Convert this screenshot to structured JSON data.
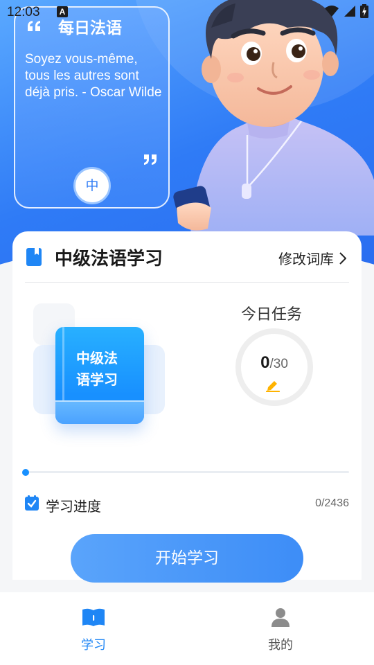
{
  "status_bar": {
    "time": "12:03",
    "notification_icon": "A"
  },
  "quote_card": {
    "title": "每日法语",
    "text": "Soyez vous-même, tous les autres sont déjà pris. - Oscar Wilde",
    "language_badge": "中"
  },
  "course": {
    "title": "中级法语学习",
    "change_library_label": "修改词库",
    "book_title": "中级法语学习",
    "today_task_label": "今日任务",
    "today_done": "0",
    "today_total": "/30",
    "progress_label": "学习进度",
    "progress_value": "0/2436",
    "progress_fraction": 0,
    "start_button": "开始学习"
  },
  "bottom_nav": {
    "items": [
      {
        "label": "学习",
        "icon": "book-icon",
        "active": true
      },
      {
        "label": "我的",
        "icon": "person-icon",
        "active": false
      }
    ]
  },
  "colors": {
    "accent": "#1f86f5",
    "hero_blue": "#2f7bf6",
    "pencil": "#ffb300"
  }
}
